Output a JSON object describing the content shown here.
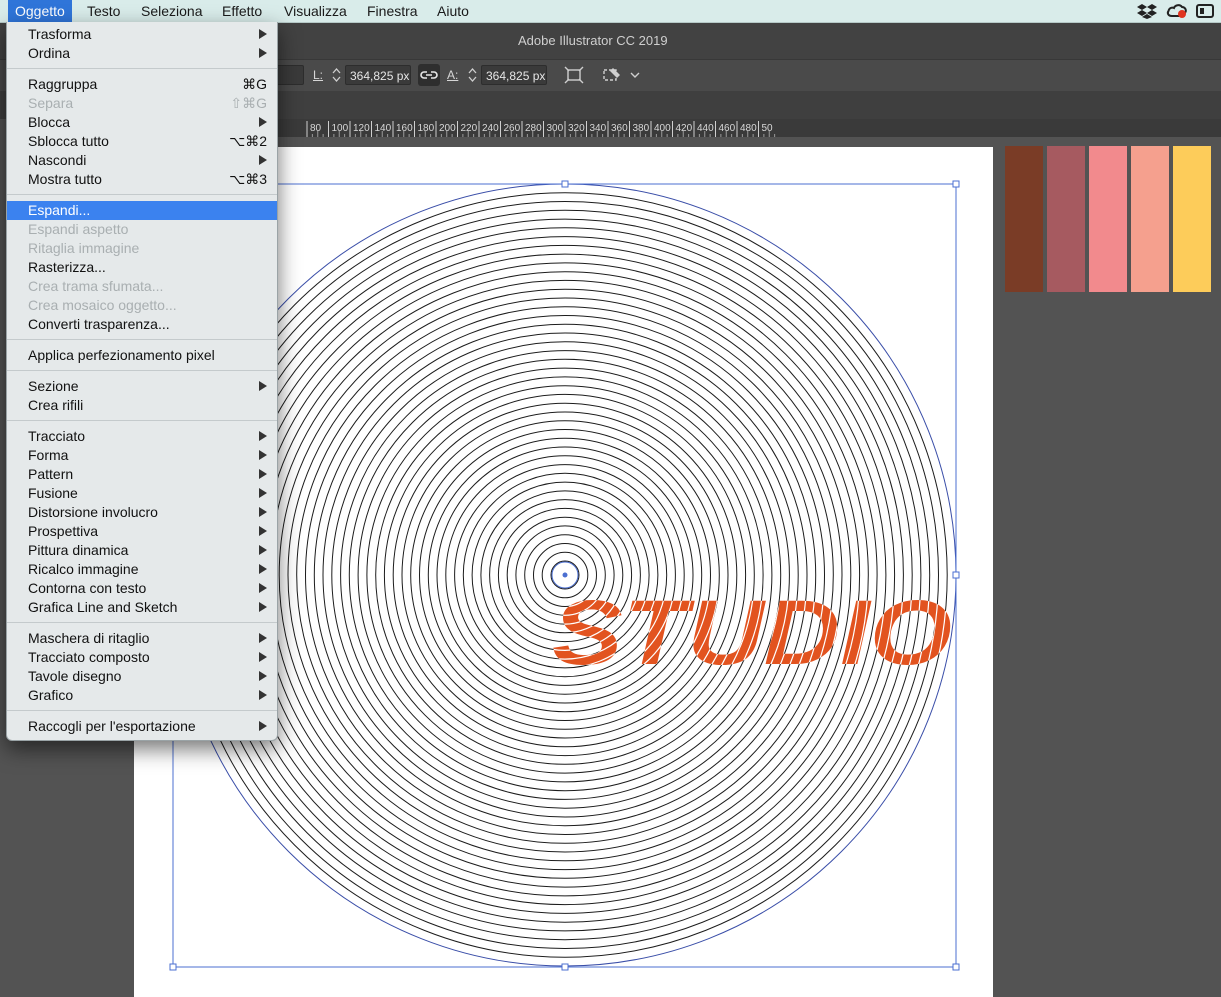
{
  "menubar": {
    "apple_hidden": "",
    "items": [
      {
        "label": "Oggetto",
        "active": true
      },
      {
        "label": "Testo"
      },
      {
        "label": "Seleziona"
      },
      {
        "label": "Effetto"
      },
      {
        "label": "Visualizza"
      },
      {
        "label": "Finestra"
      },
      {
        "label": "Aiuto"
      }
    ],
    "tray_icons": [
      "dropbox-icon",
      "creative-cloud-icon",
      "window-icon"
    ]
  },
  "window": {
    "title": "Adobe Illustrator CC 2019"
  },
  "controlbar": {
    "width_label": "L:",
    "width_value": "364,825 px",
    "height_label": "A:",
    "height_value": "364,825 px",
    "link_icon": "link-icon",
    "transform_icon": "transform-icon",
    "puppet_icon": "puppet-warp-icon"
  },
  "ruler": {
    "ticks": [
      "80",
      "100",
      "120",
      "140",
      "160",
      "180",
      "200",
      "220",
      "240",
      "260",
      "280",
      "300",
      "320",
      "340",
      "360",
      "380",
      "400",
      "420",
      "440",
      "460",
      "480",
      "50"
    ]
  },
  "canvas": {
    "text": "STUDIO",
    "text_color": "#e2531f",
    "ring_count": 44
  },
  "swatches": [
    "#7a3c26",
    "#a65a60",
    "#f28a8d",
    "#f5a08e",
    "#fdcc5a"
  ],
  "menu": {
    "items": [
      {
        "label": "Trasforma",
        "submenu": true
      },
      {
        "label": "Ordina",
        "submenu": true
      },
      {
        "sep": true
      },
      {
        "label": "Raggruppa",
        "shortcut": "⌘G"
      },
      {
        "label": "Separa",
        "shortcut": "⇧⌘G",
        "disabled": true
      },
      {
        "label": "Blocca",
        "submenu": true
      },
      {
        "label": "Sblocca tutto",
        "shortcut": "⌥⌘2"
      },
      {
        "label": "Nascondi",
        "submenu": true
      },
      {
        "label": "Mostra tutto",
        "shortcut": "⌥⌘3"
      },
      {
        "sep": true
      },
      {
        "label": "Espandi...",
        "highlight": true
      },
      {
        "label": "Espandi aspetto",
        "disabled": true
      },
      {
        "label": "Ritaglia immagine",
        "disabled": true
      },
      {
        "label": "Rasterizza..."
      },
      {
        "label": "Crea trama sfumata...",
        "disabled": true
      },
      {
        "label": "Crea mosaico oggetto...",
        "disabled": true
      },
      {
        "label": "Converti trasparenza..."
      },
      {
        "sep": true
      },
      {
        "label": "Applica perfezionamento pixel"
      },
      {
        "sep": true
      },
      {
        "label": "Sezione",
        "submenu": true
      },
      {
        "label": "Crea rifili"
      },
      {
        "sep": true
      },
      {
        "label": "Tracciato",
        "submenu": true
      },
      {
        "label": "Forma",
        "submenu": true
      },
      {
        "label": "Pattern",
        "submenu": true
      },
      {
        "label": "Fusione",
        "submenu": true
      },
      {
        "label": "Distorsione involucro",
        "submenu": true
      },
      {
        "label": "Prospettiva",
        "submenu": true
      },
      {
        "label": "Pittura dinamica",
        "submenu": true
      },
      {
        "label": "Ricalco immagine",
        "submenu": true
      },
      {
        "label": "Contorna con testo",
        "submenu": true
      },
      {
        "label": "Grafica Line and Sketch",
        "submenu": true
      },
      {
        "sep": true
      },
      {
        "label": "Maschera di ritaglio",
        "submenu": true
      },
      {
        "label": "Tracciato composto",
        "submenu": true
      },
      {
        "label": "Tavole disegno",
        "submenu": true
      },
      {
        "label": "Grafico",
        "submenu": true
      },
      {
        "sep": true
      },
      {
        "label": "Raccogli per l'esportazione",
        "submenu": true
      }
    ]
  }
}
